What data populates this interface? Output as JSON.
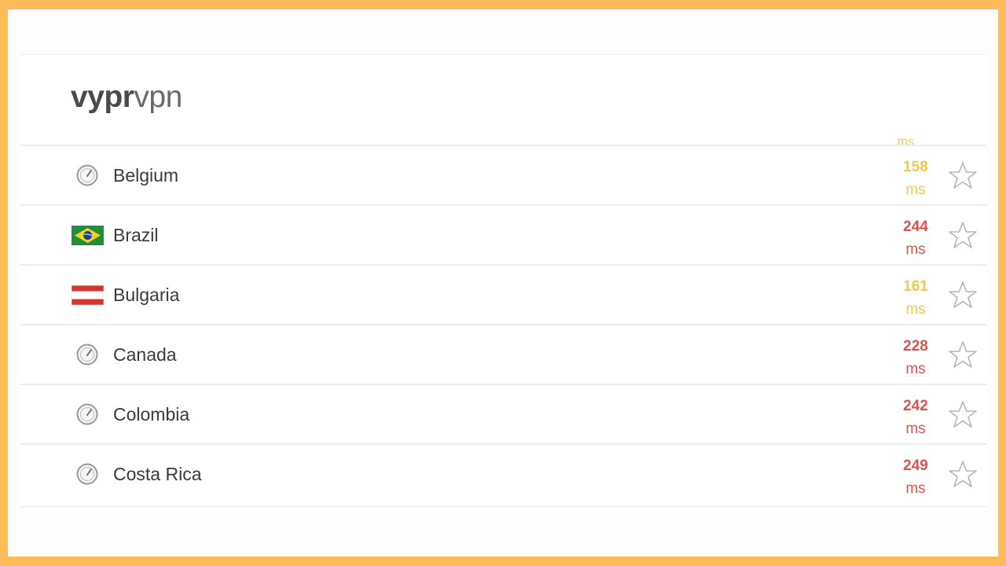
{
  "app": {
    "logo_bold": "vypr",
    "logo_light": "vpn"
  },
  "colors": {
    "frame": "#fdbb5a",
    "ping_good": "#f2c94c",
    "ping_bad": "#d9534f"
  },
  "partial_row": {
    "unit": "ms"
  },
  "servers": [
    {
      "country": "Belgium",
      "icon": "speed-gauge-icon",
      "ping": "158",
      "unit": "ms",
      "ping_status": "yellow"
    },
    {
      "country": "Brazil",
      "icon": "brazil-flag-icon",
      "ping": "244",
      "unit": "ms",
      "ping_status": "red"
    },
    {
      "country": "Bulgaria",
      "icon": "bulgaria-flag-icon",
      "ping": "161",
      "unit": "ms",
      "ping_status": "yellow"
    },
    {
      "country": "Canada",
      "icon": "speed-gauge-icon",
      "ping": "228",
      "unit": "ms",
      "ping_status": "red"
    },
    {
      "country": "Colombia",
      "icon": "speed-gauge-icon",
      "ping": "242",
      "unit": "ms",
      "ping_status": "red"
    },
    {
      "country": "Costa Rica",
      "icon": "speed-gauge-icon",
      "ping": "249",
      "unit": "ms",
      "ping_status": "red"
    }
  ]
}
